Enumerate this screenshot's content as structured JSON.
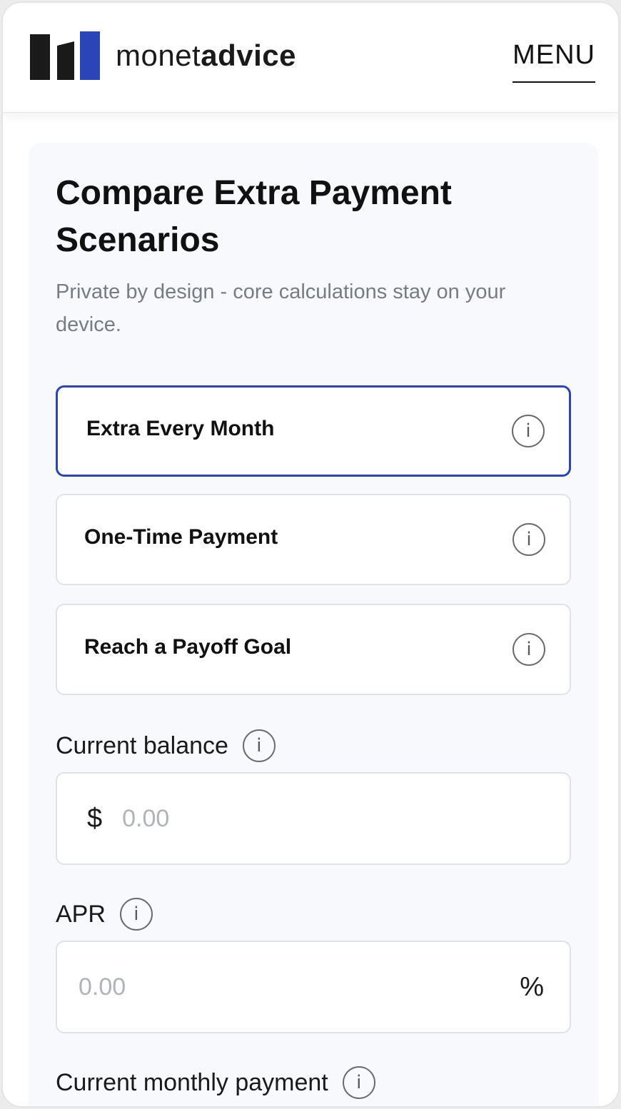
{
  "header": {
    "brand_light": "monet",
    "brand_bold": "advice",
    "menu_label": "MENU"
  },
  "colors": {
    "accent": "#2a45b8",
    "logo_dark": "#1a1a1a",
    "logo_blue": "#2a45b8"
  },
  "main": {
    "title": "Compare Extra Payment Scenarios",
    "subtitle": "Private by design - core calculations stay on your device.",
    "options": [
      {
        "label": "Extra Every Month",
        "selected": true,
        "icon": "info-icon"
      },
      {
        "label": "One-Time Payment",
        "selected": false,
        "icon": "info-icon"
      },
      {
        "label": "Reach a Payoff Goal",
        "selected": false,
        "icon": "info-icon"
      }
    ],
    "fields": {
      "balance": {
        "label": "Current balance",
        "prefix": "$",
        "placeholder": "0.00",
        "value": ""
      },
      "apr": {
        "label": "APR",
        "suffix": "%",
        "placeholder": "0.00",
        "value": ""
      },
      "monthly_payment": {
        "label": "Current monthly payment"
      }
    },
    "info_glyph": "i"
  }
}
